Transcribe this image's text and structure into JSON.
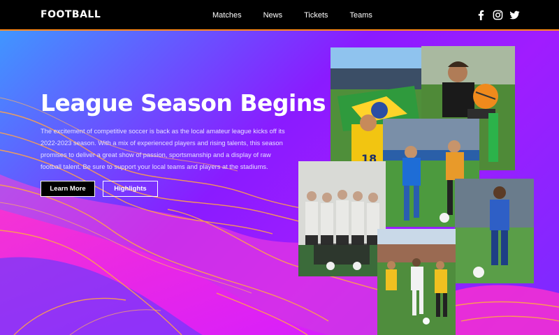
{
  "header": {
    "logo": "FOOTBALL",
    "nav": [
      "Matches",
      "News",
      "Tickets",
      "Teams"
    ],
    "social_icons": [
      "facebook-icon",
      "instagram-icon",
      "twitter-icon"
    ]
  },
  "hero": {
    "title": "League Season Begins",
    "description": "The excitement of competitive soccer is back as the local amateur league kicks off its 2022-2023 season. With a mix of experienced players and rising talents, this season promises to deliver a great show of passion, sportsmanship and a display of raw football talent. Be sure to support your local teams and players at the stadiums.",
    "primary_button": "Learn More",
    "secondary_button": "Highlights"
  },
  "colors": {
    "header_bg": "#000000",
    "accent_orange": "#ff8a1c",
    "gradient_blue": "#3aa0ff",
    "gradient_purple": "#a01cff",
    "wave_pink": "#ff2fd0"
  },
  "photos": [
    "fans-with-flag-photo",
    "female-player-with-ball-photo",
    "team-group-photo",
    "match-action-photo",
    "player-in-blue-photo",
    "youth-match-photo"
  ]
}
